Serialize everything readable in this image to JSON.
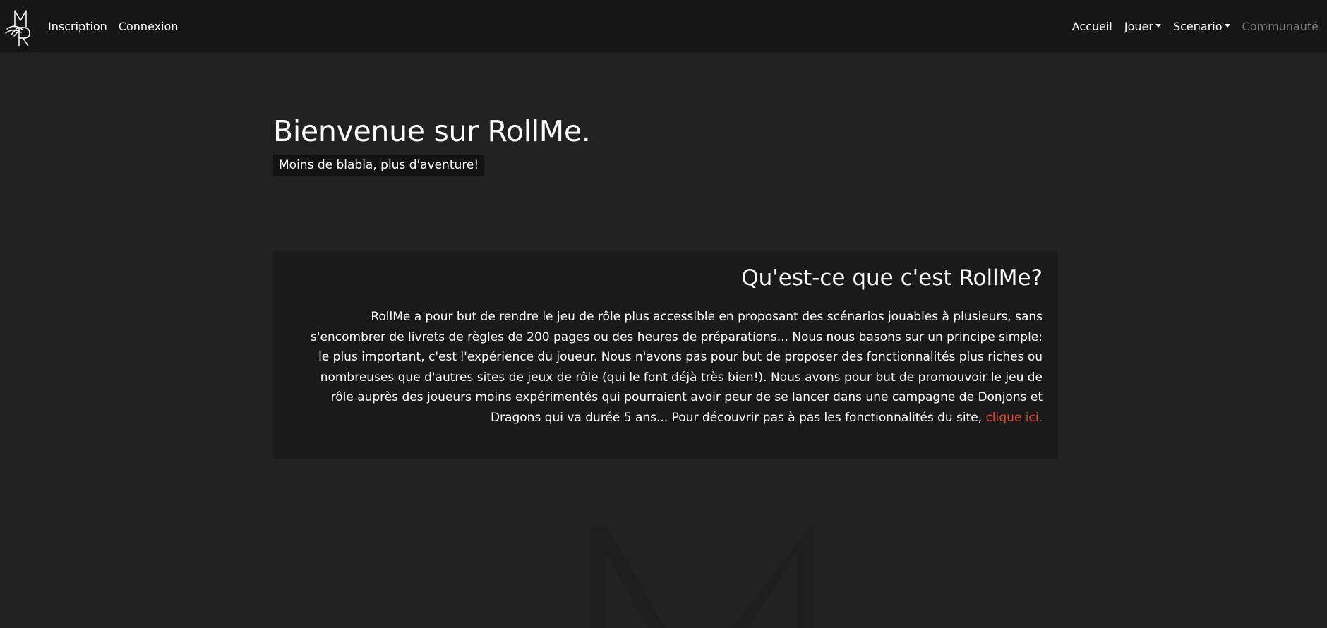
{
  "nav": {
    "left": {
      "inscription": "Inscription",
      "connexion": "Connexion"
    },
    "right": {
      "accueil": "Accueil",
      "jouer": "Jouer",
      "scenario": "Scenario",
      "communaute": "Communauté"
    }
  },
  "hero": {
    "title": "Bienvenue sur RollMe.",
    "tagline": "Moins de blabla, plus d'aventure!"
  },
  "about": {
    "title": "Qu'est-ce que c'est RollMe?",
    "line1": "RollMe a pour but de rendre le jeu de rôle plus accessible en proposant des scénarios jouables à plusieurs, sans",
    "line2": "s'encombrer de livrets de règles de 200 pages ou des heures de préparations... Nous nous basons sur un principe simple:",
    "line3": "le plus important, c'est l'expérience du joueur. Nous n'avons pas pour but de proposer des fonctionnalités plus riches ou",
    "line4": "nombreuses que d'autres sites de jeux de rôle (qui le font déjà très bien!). Nous avons pour but de promouvoir le jeu de",
    "line5": "rôle auprès des joueurs moins expérimentés qui pourraient avoir peur de se lancer dans une campagne de Donjons et",
    "line6": "Dragons qui va durée 5 ans... Pour découvrir pas à pas les fonctionnalités du site, ",
    "link": "clique ici."
  },
  "colors": {
    "page_bg": "#222222",
    "navbar_bg": "#161616",
    "card_bg": "#1a1a1a",
    "link_accent": "#e8442a",
    "muted_nav": "#7a7a7a"
  },
  "icons": {
    "brand": "rollme-logo-icon",
    "dropdown": "caret-down-icon",
    "watermark": "rollme-watermark-logo"
  }
}
